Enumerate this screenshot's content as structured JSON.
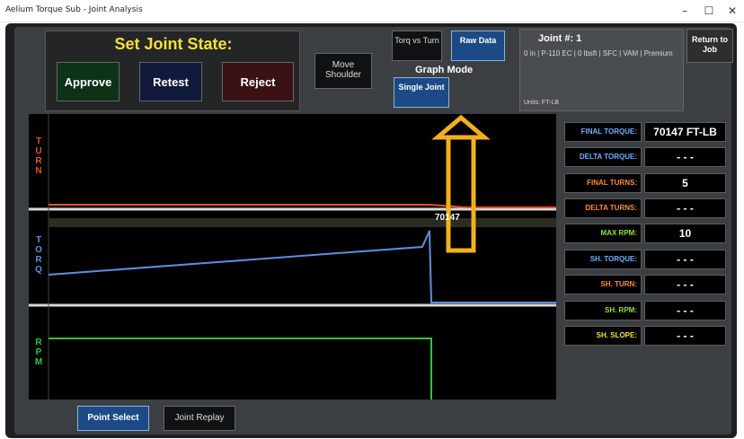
{
  "window": {
    "title": "Aelium Torque Sub - Joint Analysis",
    "minimize": "–",
    "maximize": "☐",
    "close": "✕"
  },
  "joint_state": {
    "title": "Set Joint State:",
    "approve": "Approve",
    "retest": "Retest",
    "reject": "Reject"
  },
  "move_shoulder": "Move Shoulder",
  "graph_mode": {
    "label": "Graph Mode",
    "torq_vs_turn": "Torq vs Turn",
    "raw_data": "Raw Data",
    "single_joint": "Single Joint"
  },
  "joint_info": {
    "title": "Joint #:  1",
    "description": "0 in | P-110 EC | 0 lbsft | SFC | VAM | Premium",
    "units": "Units: FT-LB"
  },
  "return_to_job": "Return to Job",
  "axis_labels": {
    "turn": [
      "T",
      "U",
      "R",
      "N"
    ],
    "torq": [
      "T",
      "O",
      "R",
      "Q"
    ],
    "rpm": [
      "R",
      "P",
      "M"
    ]
  },
  "graph_annotation": "70147",
  "readouts": [
    {
      "label": "FINAL TORQUE:",
      "value": "70147 FT-LB",
      "color": "#6fb1ff"
    },
    {
      "label": "DELTA TORQUE:",
      "value": "- - -",
      "color": "#6fb1ff"
    },
    {
      "label": "FINAL TURNS:",
      "value": "5",
      "color": "#ff8c32"
    },
    {
      "label": "DELTA TURNS:",
      "value": "- - -",
      "color": "#ff8c32"
    },
    {
      "label": "MAX RPM:",
      "value": "10",
      "color": "#8ee33b"
    },
    {
      "label": "SH. TORQUE:",
      "value": "- - -",
      "color": "#6fb1ff"
    },
    {
      "label": "SH. TURN:",
      "value": "- - -",
      "color": "#ff8c32"
    },
    {
      "label": "SH. RPM:",
      "value": "- - -",
      "color": "#8ee33b"
    },
    {
      "label": "SH. SLOPE:",
      "value": "- - -",
      "color": "#f4e03a"
    }
  ],
  "bottom": {
    "point_select": "Point Select",
    "joint_replay": "Joint Replay"
  },
  "colors": {
    "turn": "#e8502a",
    "torq": "#5d8fe0",
    "rpm": "#35c33a",
    "accent_yellow": "#f4e03a",
    "arrow": "#f2b01e"
  }
}
